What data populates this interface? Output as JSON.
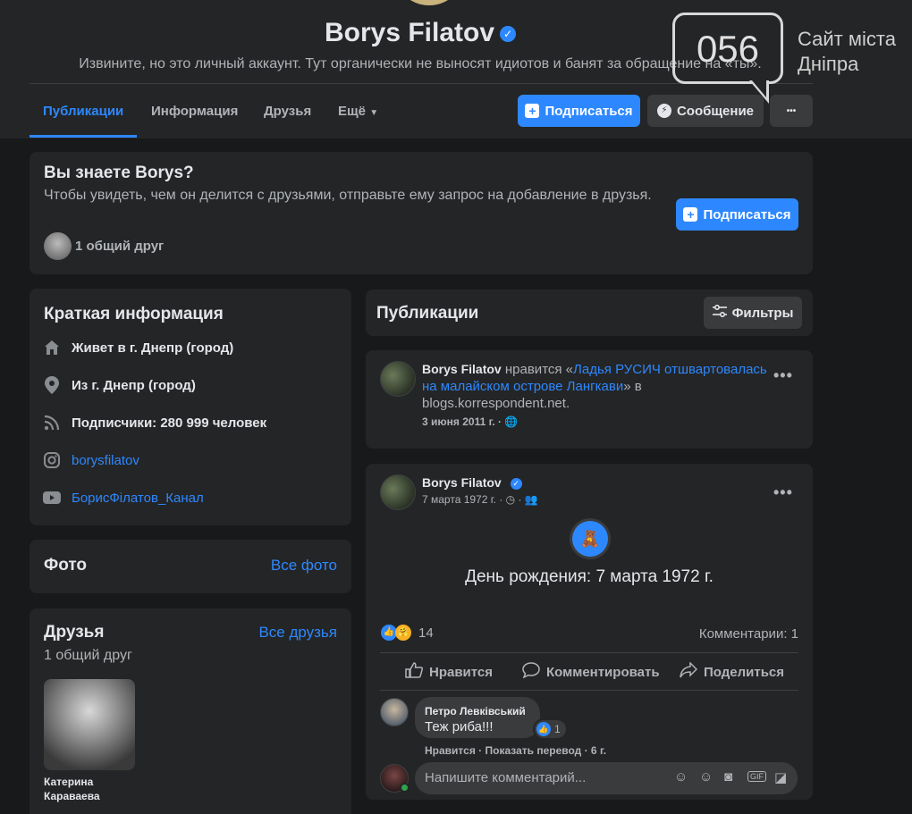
{
  "profile": {
    "name": "Borys Filatov",
    "bio": "Извините, но это личный аккаунт. Тут органически не выносят идиотов и банят за обращение на «ты»."
  },
  "tabs": [
    "Публикации",
    "Информация",
    "Друзья",
    "Ещё"
  ],
  "actions": {
    "subscribe": "Подписаться",
    "message": "Сообщение",
    "more": "•••"
  },
  "watermark": {
    "number": "056",
    "line1": "Сайт міста",
    "line2": "Дніпра"
  },
  "know": {
    "title": "Вы знаете Borys?",
    "text": "Чтобы увидеть, чем он делится с друзьями, отправьте ему запрос на добавление в друзья.",
    "mutual": "1 общий друг",
    "subscribe": "Подписаться"
  },
  "intro": {
    "title": "Краткая информация",
    "lives": "Живет в г. Днепр (город)",
    "from": "Из г. Днепр (город)",
    "followers": "Подписчики: 280 999 человек",
    "instagram": "borysfilatov",
    "youtube": "БорисФілатов_Канал"
  },
  "photos": {
    "title": "Фото",
    "all": "Все фото"
  },
  "friends": {
    "title": "Друзья",
    "all": "Все друзья",
    "count": "1 общий друг",
    "friend_first": "Катерина",
    "friend_last": "Караваева"
  },
  "posts_header": {
    "title": "Публикации",
    "filters": "Фильтры"
  },
  "post1": {
    "author": "Borys Filatov",
    "likes": "нравится «",
    "link": "Ладья РУСИЧ отшвартовалась на малайском острове Лангкави",
    "after_link": "» в",
    "source": "blogs.korrespondent.net.",
    "date": "3 июня 2011 г. ·"
  },
  "post2": {
    "author": "Borys Filatov",
    "date": "7 марта 1972 г. ·",
    "event": "День рождения: 7 марта 1972 г.",
    "reactions": "14",
    "comments_count": "Комментарии: 1",
    "like": "Нравится",
    "comment": "Комментировать",
    "share": "Поделиться"
  },
  "comment": {
    "author": "Петро Левківський",
    "text": "Теж риба!!!",
    "likes": "1",
    "meta": "Нравится · Показать перевод · 6 г."
  },
  "composer": {
    "placeholder": "Напишите комментарий..."
  }
}
